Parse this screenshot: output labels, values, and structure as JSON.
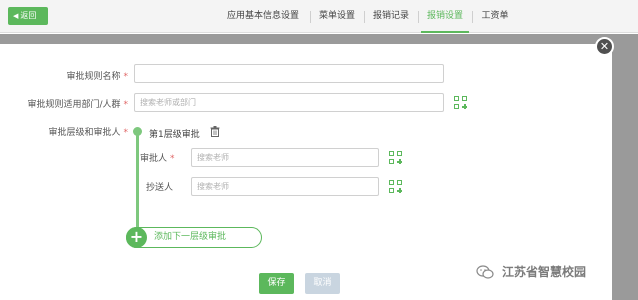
{
  "topbar": {
    "back_label": "返回",
    "tabs": [
      {
        "label": "应用基本信息设置"
      },
      {
        "label": "菜单设置"
      },
      {
        "label": "报销记录"
      },
      {
        "label": "报销设置"
      },
      {
        "label": "工资单"
      }
    ],
    "active_tab": "报销设置"
  },
  "form": {
    "rule_name": {
      "label": "审批规则名称",
      "value": "",
      "placeholder": ""
    },
    "scope": {
      "label": "审批规则适用部门/人群",
      "value": "",
      "placeholder": "搜索老师或部门"
    },
    "levels_label": "审批层级和审批人",
    "level": {
      "title": "第1层级审批",
      "approver": {
        "label": "审批人",
        "placeholder": "搜索老师"
      },
      "cc": {
        "label": "抄送人",
        "placeholder": "搜索老师"
      }
    },
    "add_level_label": "添加下一层级审批",
    "required_mark": "*"
  },
  "actions": {
    "save_label": "保存",
    "cancel_label": "取消"
  },
  "watermark": {
    "text": "江苏省智慧校园"
  },
  "colors": {
    "accent": "#5cb85c",
    "cancel": "#c9d5e0",
    "overlay": "#9a9a9a"
  },
  "icons": {
    "back": "arrow-left-icon",
    "close": "close-icon",
    "add_person": "add-person-icon",
    "trash": "trash-icon",
    "plus": "plus-icon",
    "wechat": "wechat-icon"
  }
}
